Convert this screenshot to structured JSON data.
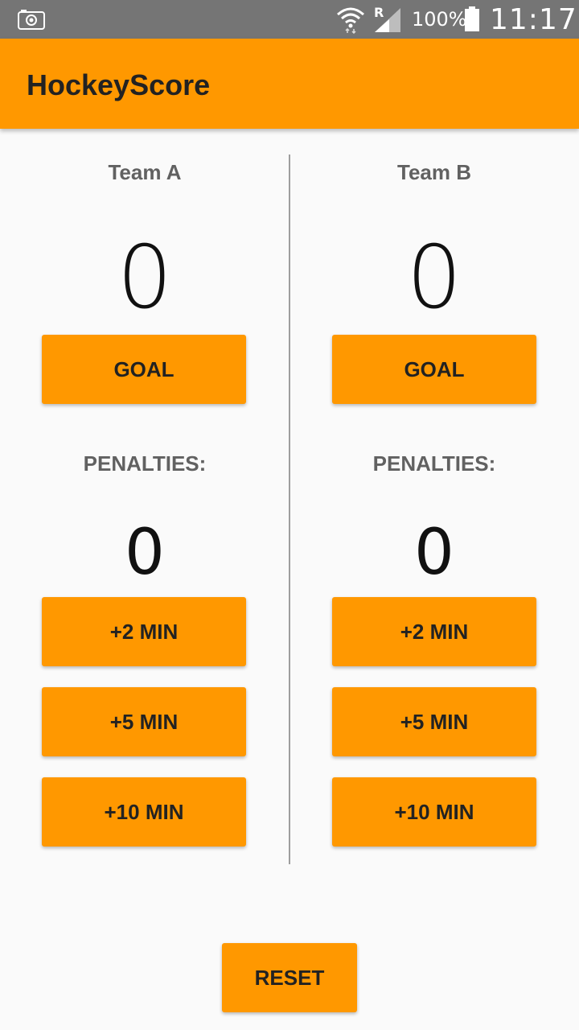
{
  "status_bar": {
    "battery_text": "100%",
    "time": "11:17",
    "signal_indicator": "R",
    "icons": [
      "camera-icon",
      "wifi-icon",
      "signal-icon",
      "battery-icon"
    ]
  },
  "app_bar": {
    "title": "HockeyScore",
    "color": "#ff9800"
  },
  "team_a": {
    "name": "Team A",
    "score": "0",
    "goal_label": "GOAL",
    "penalties_label": "PENALTIES:",
    "penalties": "0",
    "plus2_label": "+2 MIN",
    "plus5_label": "+5 MIN",
    "plus10_label": "+10 MIN"
  },
  "team_b": {
    "name": "Team B",
    "score": "0",
    "goal_label": "GOAL",
    "penalties_label": "PENALTIES:",
    "penalties": "0",
    "plus2_label": "+2 MIN",
    "plus5_label": "+5 MIN",
    "plus10_label": "+10 MIN"
  },
  "reset_label": "RESET",
  "colors": {
    "accent": "#ff9800",
    "status_bar": "#757575",
    "background": "#fafafa",
    "divider": "#9e9e9e"
  }
}
